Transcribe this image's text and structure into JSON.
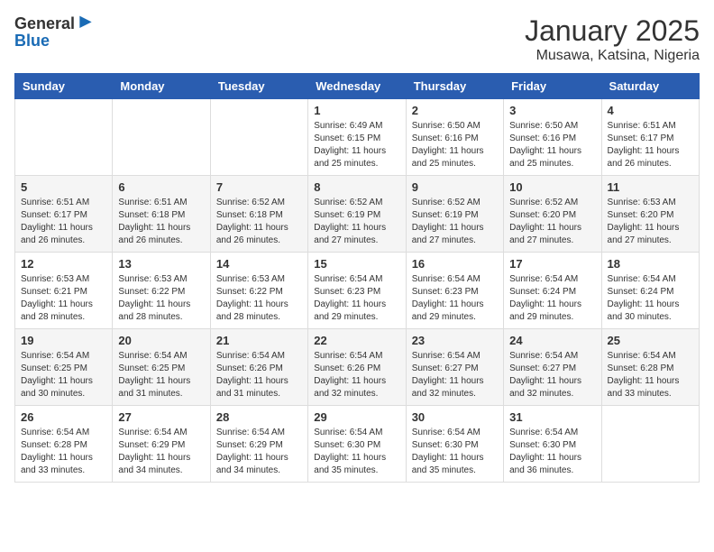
{
  "header": {
    "logo_general": "General",
    "logo_blue": "Blue",
    "title": "January 2025",
    "subtitle": "Musawa, Katsina, Nigeria"
  },
  "weekdays": [
    "Sunday",
    "Monday",
    "Tuesday",
    "Wednesday",
    "Thursday",
    "Friday",
    "Saturday"
  ],
  "weeks": [
    [
      {
        "day": "",
        "info": ""
      },
      {
        "day": "",
        "info": ""
      },
      {
        "day": "",
        "info": ""
      },
      {
        "day": "1",
        "info": "Sunrise: 6:49 AM\nSunset: 6:15 PM\nDaylight: 11 hours and 25 minutes."
      },
      {
        "day": "2",
        "info": "Sunrise: 6:50 AM\nSunset: 6:16 PM\nDaylight: 11 hours and 25 minutes."
      },
      {
        "day": "3",
        "info": "Sunrise: 6:50 AM\nSunset: 6:16 PM\nDaylight: 11 hours and 25 minutes."
      },
      {
        "day": "4",
        "info": "Sunrise: 6:51 AM\nSunset: 6:17 PM\nDaylight: 11 hours and 26 minutes."
      }
    ],
    [
      {
        "day": "5",
        "info": "Sunrise: 6:51 AM\nSunset: 6:17 PM\nDaylight: 11 hours and 26 minutes."
      },
      {
        "day": "6",
        "info": "Sunrise: 6:51 AM\nSunset: 6:18 PM\nDaylight: 11 hours and 26 minutes."
      },
      {
        "day": "7",
        "info": "Sunrise: 6:52 AM\nSunset: 6:18 PM\nDaylight: 11 hours and 26 minutes."
      },
      {
        "day": "8",
        "info": "Sunrise: 6:52 AM\nSunset: 6:19 PM\nDaylight: 11 hours and 27 minutes."
      },
      {
        "day": "9",
        "info": "Sunrise: 6:52 AM\nSunset: 6:19 PM\nDaylight: 11 hours and 27 minutes."
      },
      {
        "day": "10",
        "info": "Sunrise: 6:52 AM\nSunset: 6:20 PM\nDaylight: 11 hours and 27 minutes."
      },
      {
        "day": "11",
        "info": "Sunrise: 6:53 AM\nSunset: 6:20 PM\nDaylight: 11 hours and 27 minutes."
      }
    ],
    [
      {
        "day": "12",
        "info": "Sunrise: 6:53 AM\nSunset: 6:21 PM\nDaylight: 11 hours and 28 minutes."
      },
      {
        "day": "13",
        "info": "Sunrise: 6:53 AM\nSunset: 6:22 PM\nDaylight: 11 hours and 28 minutes."
      },
      {
        "day": "14",
        "info": "Sunrise: 6:53 AM\nSunset: 6:22 PM\nDaylight: 11 hours and 28 minutes."
      },
      {
        "day": "15",
        "info": "Sunrise: 6:54 AM\nSunset: 6:23 PM\nDaylight: 11 hours and 29 minutes."
      },
      {
        "day": "16",
        "info": "Sunrise: 6:54 AM\nSunset: 6:23 PM\nDaylight: 11 hours and 29 minutes."
      },
      {
        "day": "17",
        "info": "Sunrise: 6:54 AM\nSunset: 6:24 PM\nDaylight: 11 hours and 29 minutes."
      },
      {
        "day": "18",
        "info": "Sunrise: 6:54 AM\nSunset: 6:24 PM\nDaylight: 11 hours and 30 minutes."
      }
    ],
    [
      {
        "day": "19",
        "info": "Sunrise: 6:54 AM\nSunset: 6:25 PM\nDaylight: 11 hours and 30 minutes."
      },
      {
        "day": "20",
        "info": "Sunrise: 6:54 AM\nSunset: 6:25 PM\nDaylight: 11 hours and 31 minutes."
      },
      {
        "day": "21",
        "info": "Sunrise: 6:54 AM\nSunset: 6:26 PM\nDaylight: 11 hours and 31 minutes."
      },
      {
        "day": "22",
        "info": "Sunrise: 6:54 AM\nSunset: 6:26 PM\nDaylight: 11 hours and 32 minutes."
      },
      {
        "day": "23",
        "info": "Sunrise: 6:54 AM\nSunset: 6:27 PM\nDaylight: 11 hours and 32 minutes."
      },
      {
        "day": "24",
        "info": "Sunrise: 6:54 AM\nSunset: 6:27 PM\nDaylight: 11 hours and 32 minutes."
      },
      {
        "day": "25",
        "info": "Sunrise: 6:54 AM\nSunset: 6:28 PM\nDaylight: 11 hours and 33 minutes."
      }
    ],
    [
      {
        "day": "26",
        "info": "Sunrise: 6:54 AM\nSunset: 6:28 PM\nDaylight: 11 hours and 33 minutes."
      },
      {
        "day": "27",
        "info": "Sunrise: 6:54 AM\nSunset: 6:29 PM\nDaylight: 11 hours and 34 minutes."
      },
      {
        "day": "28",
        "info": "Sunrise: 6:54 AM\nSunset: 6:29 PM\nDaylight: 11 hours and 34 minutes."
      },
      {
        "day": "29",
        "info": "Sunrise: 6:54 AM\nSunset: 6:30 PM\nDaylight: 11 hours and 35 minutes."
      },
      {
        "day": "30",
        "info": "Sunrise: 6:54 AM\nSunset: 6:30 PM\nDaylight: 11 hours and 35 minutes."
      },
      {
        "day": "31",
        "info": "Sunrise: 6:54 AM\nSunset: 6:30 PM\nDaylight: 11 hours and 36 minutes."
      },
      {
        "day": "",
        "info": ""
      }
    ]
  ]
}
